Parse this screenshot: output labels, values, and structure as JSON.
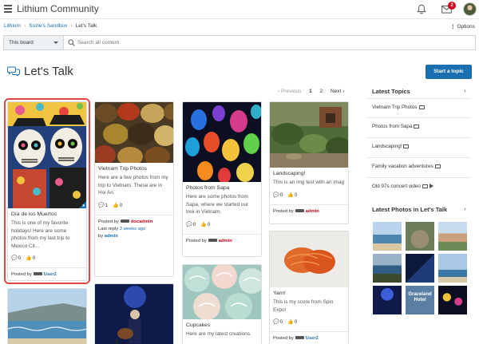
{
  "header": {
    "brand": "Lithium Community",
    "notification_count": "2"
  },
  "breadcrumb": {
    "items": [
      "Lithium",
      "Suzie's Sandbox",
      "Let's Talk"
    ],
    "options_label": "Options"
  },
  "search": {
    "board_label": "This board",
    "placeholder": "Search all content"
  },
  "page": {
    "title": "Let's Talk",
    "start_button": "Start a topic"
  },
  "pagination": {
    "previous": "‹ Previous",
    "pages": [
      "1",
      "2"
    ],
    "next": "Next ›",
    "current": "1"
  },
  "cards": [
    {
      "title": "Día de los Muertos",
      "description": "This is one of my favorite holidays! Here are some photos from my last trip to Mexico Cit...",
      "comments": "0",
      "kudos": "0",
      "posted_by_label": "Posted by",
      "author": "User2"
    },
    {
      "title": "Vietnam Trip Photos",
      "description": "Here are a few photos from my trip to Vietnam. These are in Hoi An.",
      "comments": "1",
      "kudos": "0",
      "posted_by_label": "Posted by",
      "author": "docadmin",
      "last_reply_label": "Last reply",
      "last_reply_time": "3 weeks ago",
      "by_label": "by",
      "last_reply_by": "admin"
    },
    {
      "title": "Photos from Sapa",
      "description": "Here are some photos from Sapa, where we started our trek in Vietnam.",
      "comments": "0",
      "kudos": "0",
      "posted_by_label": "Posted by",
      "author": "admin"
    },
    {
      "title": "Landscaping!",
      "description": "This is an img test with an imag",
      "comments": "0",
      "kudos": "0",
      "posted_by_label": "Posted by",
      "author": "admin"
    },
    {
      "title": "Yarn!",
      "description": "This is my score from Spin Expo!",
      "comments": "0",
      "kudos": "0",
      "posted_by_label": "Posted by",
      "author": "User2"
    },
    {
      "title": "Cupcakes",
      "description": "Here are my latest creations."
    }
  ],
  "sidebar": {
    "latest_topics_title": "Latest Topics",
    "topics": [
      "Vietnam Trip Photos",
      "Photos from Sapa",
      "Landscaping!",
      "Family vacation adventures",
      "Old 97s concert video"
    ],
    "latest_photos_title": "Latest Photos in Let's Talk",
    "photo_sign_text": "Graceland Hotel"
  },
  "colors": {
    "accent": "#1a6fb0",
    "user_red": "#d0021b",
    "selection": "#e04646"
  }
}
